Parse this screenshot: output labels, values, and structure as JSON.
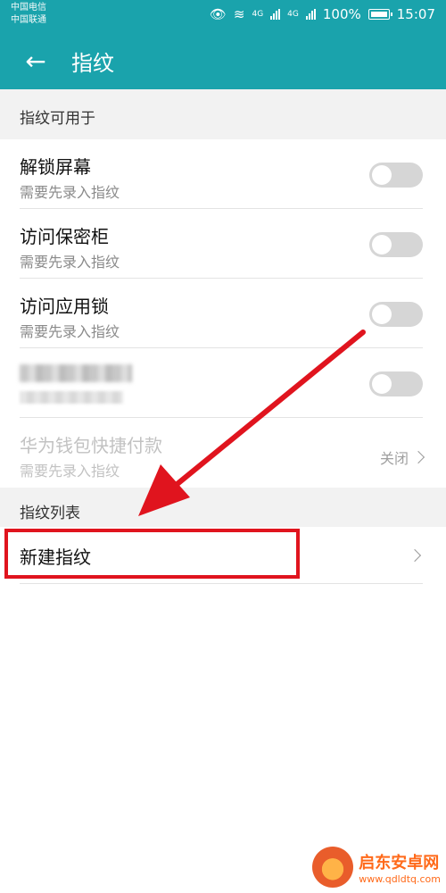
{
  "status_bar": {
    "carrier1": "中国电信",
    "carrier2": "中国联通",
    "net1": "4G",
    "net2": "4G",
    "battery": "100%",
    "time": "15:07"
  },
  "app_bar": {
    "title": "指纹",
    "back_icon": "arrow-left-icon"
  },
  "sections": [
    {
      "header": "指纹可用于"
    },
    {
      "header": "指纹列表"
    }
  ],
  "items": [
    {
      "title": "解锁屏幕",
      "subtitle": "需要先录入指纹",
      "toggle_on": false
    },
    {
      "title": "访问保密柜",
      "subtitle": "需要先录入指纹",
      "toggle_on": false
    },
    {
      "title": "访问应用锁",
      "subtitle": "需要先录入指纹",
      "toggle_on": false
    },
    {
      "title": "",
      "subtitle": "",
      "toggle_on": false
    },
    {
      "title": "华为钱包快捷付款",
      "subtitle": "需要先录入指纹",
      "value": "关闭",
      "disabled": true
    }
  ],
  "new_fingerprint": {
    "label": "新建指纹"
  },
  "watermark": {
    "name": "启东安卓网",
    "url": "www.qdldtq.com"
  },
  "colors": {
    "header": "#1aa3ac",
    "annotation": "#e0141e"
  }
}
